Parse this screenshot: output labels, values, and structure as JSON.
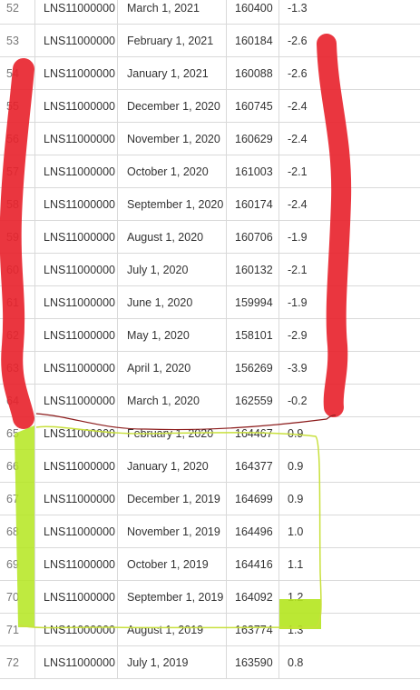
{
  "rows": [
    {
      "row": "52",
      "series": "LNS11000000",
      "date": "March 1, 2021",
      "value": "160400",
      "change": "-1.3"
    },
    {
      "row": "53",
      "series": "LNS11000000",
      "date": "February 1, 2021",
      "value": "160184",
      "change": "-2.6"
    },
    {
      "row": "54",
      "series": "LNS11000000",
      "date": "January 1, 2021",
      "value": "160088",
      "change": "-2.6"
    },
    {
      "row": "55",
      "series": "LNS11000000",
      "date": "December 1, 2020",
      "value": "160745",
      "change": "-2.4"
    },
    {
      "row": "56",
      "series": "LNS11000000",
      "date": "November 1, 2020",
      "value": "160629",
      "change": "-2.4"
    },
    {
      "row": "57",
      "series": "LNS11000000",
      "date": "October 1, 2020",
      "value": "161003",
      "change": "-2.1"
    },
    {
      "row": "58",
      "series": "LNS11000000",
      "date": "September 1, 2020",
      "value": "160174",
      "change": "-2.4"
    },
    {
      "row": "59",
      "series": "LNS11000000",
      "date": "August 1, 2020",
      "value": "160706",
      "change": "-1.9"
    },
    {
      "row": "60",
      "series": "LNS11000000",
      "date": "July 1, 2020",
      "value": "160132",
      "change": "-2.1"
    },
    {
      "row": "61",
      "series": "LNS11000000",
      "date": "June 1, 2020",
      "value": "159994",
      "change": "-1.9"
    },
    {
      "row": "62",
      "series": "LNS11000000",
      "date": "May 1, 2020",
      "value": "158101",
      "change": "-2.9"
    },
    {
      "row": "63",
      "series": "LNS11000000",
      "date": "April 1, 2020",
      "value": "156269",
      "change": "-3.9"
    },
    {
      "row": "64",
      "series": "LNS11000000",
      "date": "March 1, 2020",
      "value": "162559",
      "change": "-0.2"
    },
    {
      "row": "65",
      "series": "LNS11000000",
      "date": "February 1, 2020",
      "value": "164467",
      "change": "0.9"
    },
    {
      "row": "66",
      "series": "LNS11000000",
      "date": "January 1, 2020",
      "value": "164377",
      "change": "0.9"
    },
    {
      "row": "67",
      "series": "LNS11000000",
      "date": "December 1, 2019",
      "value": "164699",
      "change": "0.9"
    },
    {
      "row": "68",
      "series": "LNS11000000",
      "date": "November 1, 2019",
      "value": "164496",
      "change": "1.0"
    },
    {
      "row": "69",
      "series": "LNS11000000",
      "date": "October 1, 2019",
      "value": "164416",
      "change": "1.1"
    },
    {
      "row": "70",
      "series": "LNS11000000",
      "date": "September 1, 2019",
      "value": "164092",
      "change": "1.2"
    },
    {
      "row": "71",
      "series": "LNS11000000",
      "date": "August 1, 2019",
      "value": "163774",
      "change": "1.3"
    },
    {
      "row": "72",
      "series": "LNS11000000",
      "date": "July 1, 2019",
      "value": "163590",
      "change": "0.8"
    }
  ],
  "colors": {
    "red_marker": "#e8202a",
    "green_highlight": "#b4e61e",
    "green_outline": "#c8e03c",
    "dark_red_line": "#8b1a1a",
    "grid": "#d9d9d9"
  }
}
